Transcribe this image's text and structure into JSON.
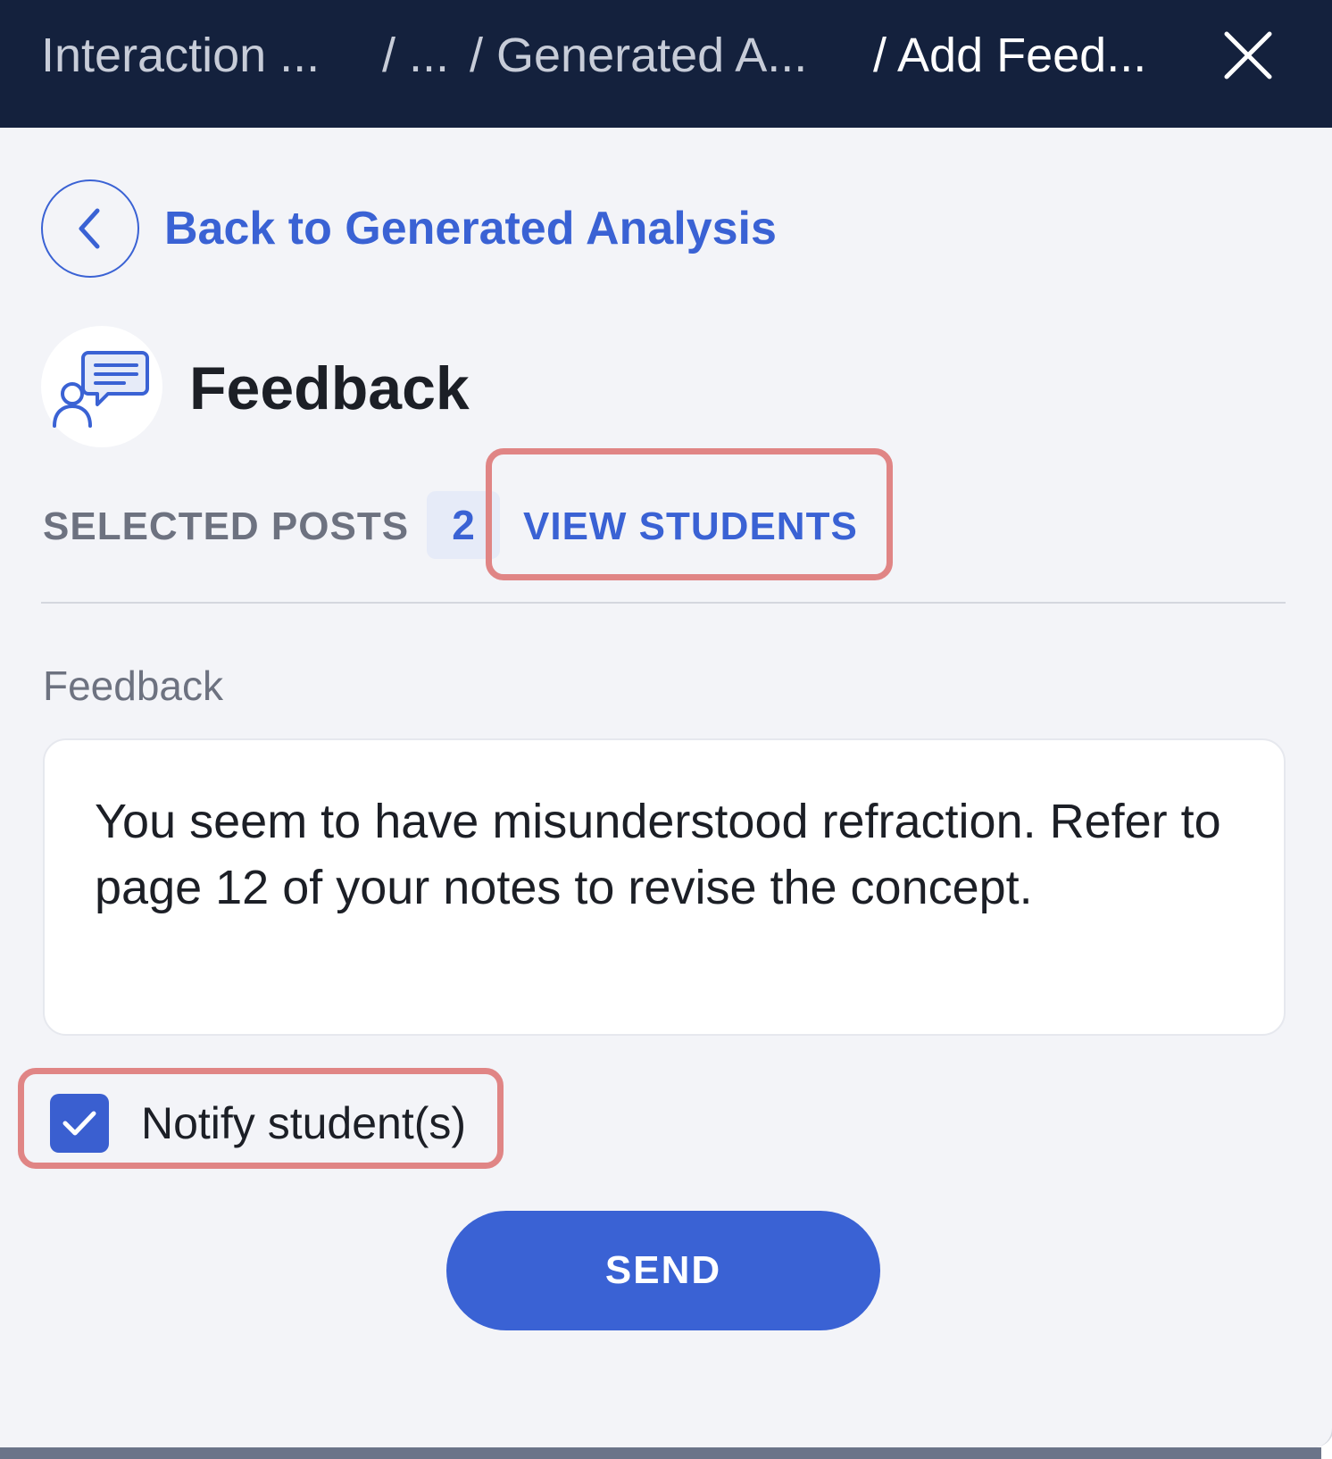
{
  "breadcrumb": {
    "items": [
      {
        "label": "Interaction ..."
      },
      {
        "label": "/ ..."
      },
      {
        "label": "/ Generated A..."
      },
      {
        "label": "/ Add Feed..."
      }
    ]
  },
  "icons": {
    "close": "close-icon",
    "back": "chevron-left-icon",
    "feedback": "feedback-chat-icon",
    "check": "checkmark-icon"
  },
  "back_link": {
    "label": "Back to Generated Analysis"
  },
  "header": {
    "title": "Feedback"
  },
  "selected_posts": {
    "label": "SELECTED POSTS",
    "count": "2",
    "view_students_label": "VIEW STUDENTS"
  },
  "feedback_field": {
    "label": "Feedback",
    "value": "You seem to have misunderstood refraction. Refer to page 12 of your notes to revise the concept."
  },
  "notify": {
    "label": "Notify student(s)",
    "checked": true
  },
  "send_button": {
    "label": "SEND"
  },
  "colors": {
    "topbar": "#14213d",
    "accent": "#3a62d4",
    "highlight": "#e08585",
    "panel_bg": "#f3f4f8"
  }
}
